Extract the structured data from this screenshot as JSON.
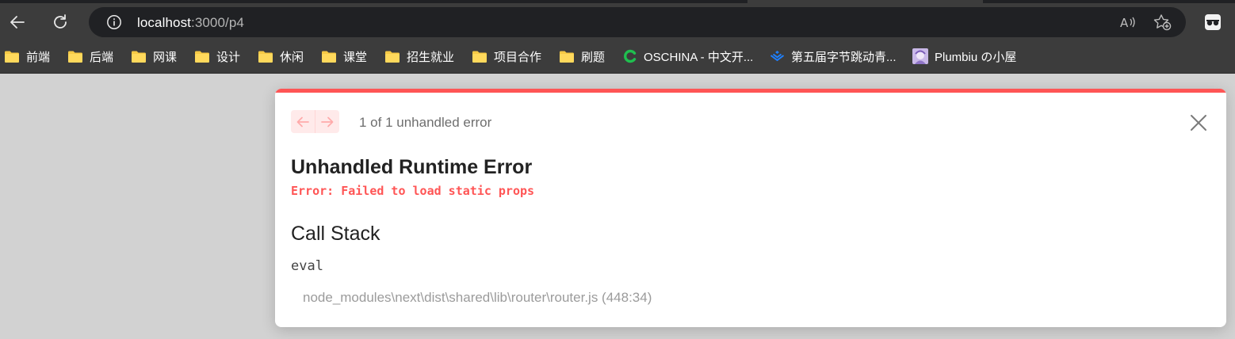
{
  "browser": {
    "address": {
      "host": "localhost",
      "path": ":3000/p4"
    },
    "bookmarks": [
      {
        "label": "前端",
        "icon": "folder-icon"
      },
      {
        "label": "后端",
        "icon": "folder-icon"
      },
      {
        "label": "网课",
        "icon": "folder-icon"
      },
      {
        "label": "设计",
        "icon": "folder-icon"
      },
      {
        "label": "休闲",
        "icon": "folder-icon"
      },
      {
        "label": "课堂",
        "icon": "folder-icon"
      },
      {
        "label": "招生就业",
        "icon": "folder-icon"
      },
      {
        "label": "项目合作",
        "icon": "folder-icon"
      },
      {
        "label": "刷题",
        "icon": "folder-icon"
      },
      {
        "label": "OSCHINA - 中文开...",
        "icon": "oschina-icon"
      },
      {
        "label": "第五届字节跳动青...",
        "icon": "juejin-icon"
      },
      {
        "label": "Plumbiu の小屋",
        "icon": "avatar-icon"
      }
    ]
  },
  "dialog": {
    "counter": "1 of 1 unhandled error",
    "title": "Unhandled Runtime Error",
    "message": "Error: Failed to load static props",
    "stack_title": "Call Stack",
    "frames": [
      {
        "fn": "eval",
        "location": "node_modules\\next\\dist\\shared\\lib\\router\\router.js (448:34)"
      }
    ]
  },
  "colors": {
    "accent": "#ff5555",
    "page_bg": "#d2d2d2",
    "chrome_bg": "#3c3c3c",
    "folder": "#f6c945"
  }
}
